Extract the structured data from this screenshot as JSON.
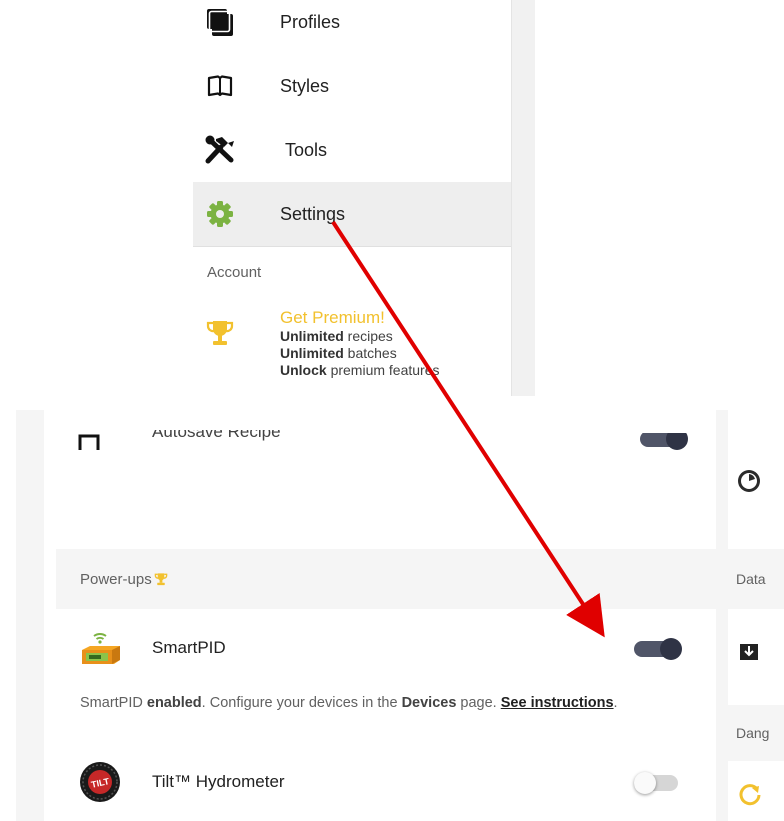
{
  "menu": {
    "items": [
      {
        "label": "Profiles",
        "icon": "profiles-icon"
      },
      {
        "label": "Styles",
        "icon": "book-icon"
      },
      {
        "label": "Tools",
        "icon": "tools-icon"
      },
      {
        "label": "Settings",
        "icon": "gear-icon"
      }
    ],
    "section_label": "Account",
    "premium": {
      "title": "Get Premium!",
      "line1_bold": "Unlimited",
      "line1_rest": " recipes",
      "line2_bold": "Unlimited",
      "line2_rest": " batches",
      "line3_bold": "Unlock",
      "line3_rest": " premium features"
    }
  },
  "settings": {
    "autosave_label": "Autosave Recipe",
    "powerups_header": "Power-ups",
    "smartpid": {
      "label": "SmartPID",
      "enabled": true,
      "note_prefix": "SmartPID ",
      "note_enabled": "enabled",
      "note_mid": ". Configure your devices in the ",
      "note_devices": "Devices",
      "note_after": " page. ",
      "note_link": "See instructions",
      "note_end": "."
    },
    "tilt": {
      "label": "Tilt™ Hydrometer",
      "enabled": false
    },
    "right_column": {
      "data_label": "Data",
      "danger_label": "Dang"
    }
  },
  "colors": {
    "accent_green": "#7cb342",
    "premium_yellow": "#f2c12e",
    "annotation_red": "#e00000",
    "toggle_on": "#2f3345"
  }
}
